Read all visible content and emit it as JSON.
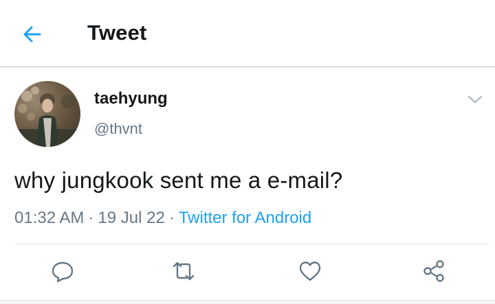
{
  "header": {
    "title": "Tweet",
    "back_icon": "arrow-left-icon",
    "accent_color": "#1da1f2"
  },
  "tweet": {
    "display_name": "taehyung",
    "handle": "@thvnt",
    "text": "why jungkook sent me a e-mail?",
    "time": "01:32 AM",
    "date": "19 Jul 22",
    "separator": "·",
    "source": "Twitter for Android"
  },
  "actions": [
    {
      "name": "reply",
      "icon": "reply-icon"
    },
    {
      "name": "retweet",
      "icon": "retweet-icon"
    },
    {
      "name": "like",
      "icon": "heart-icon"
    },
    {
      "name": "share",
      "icon": "share-icon"
    }
  ]
}
